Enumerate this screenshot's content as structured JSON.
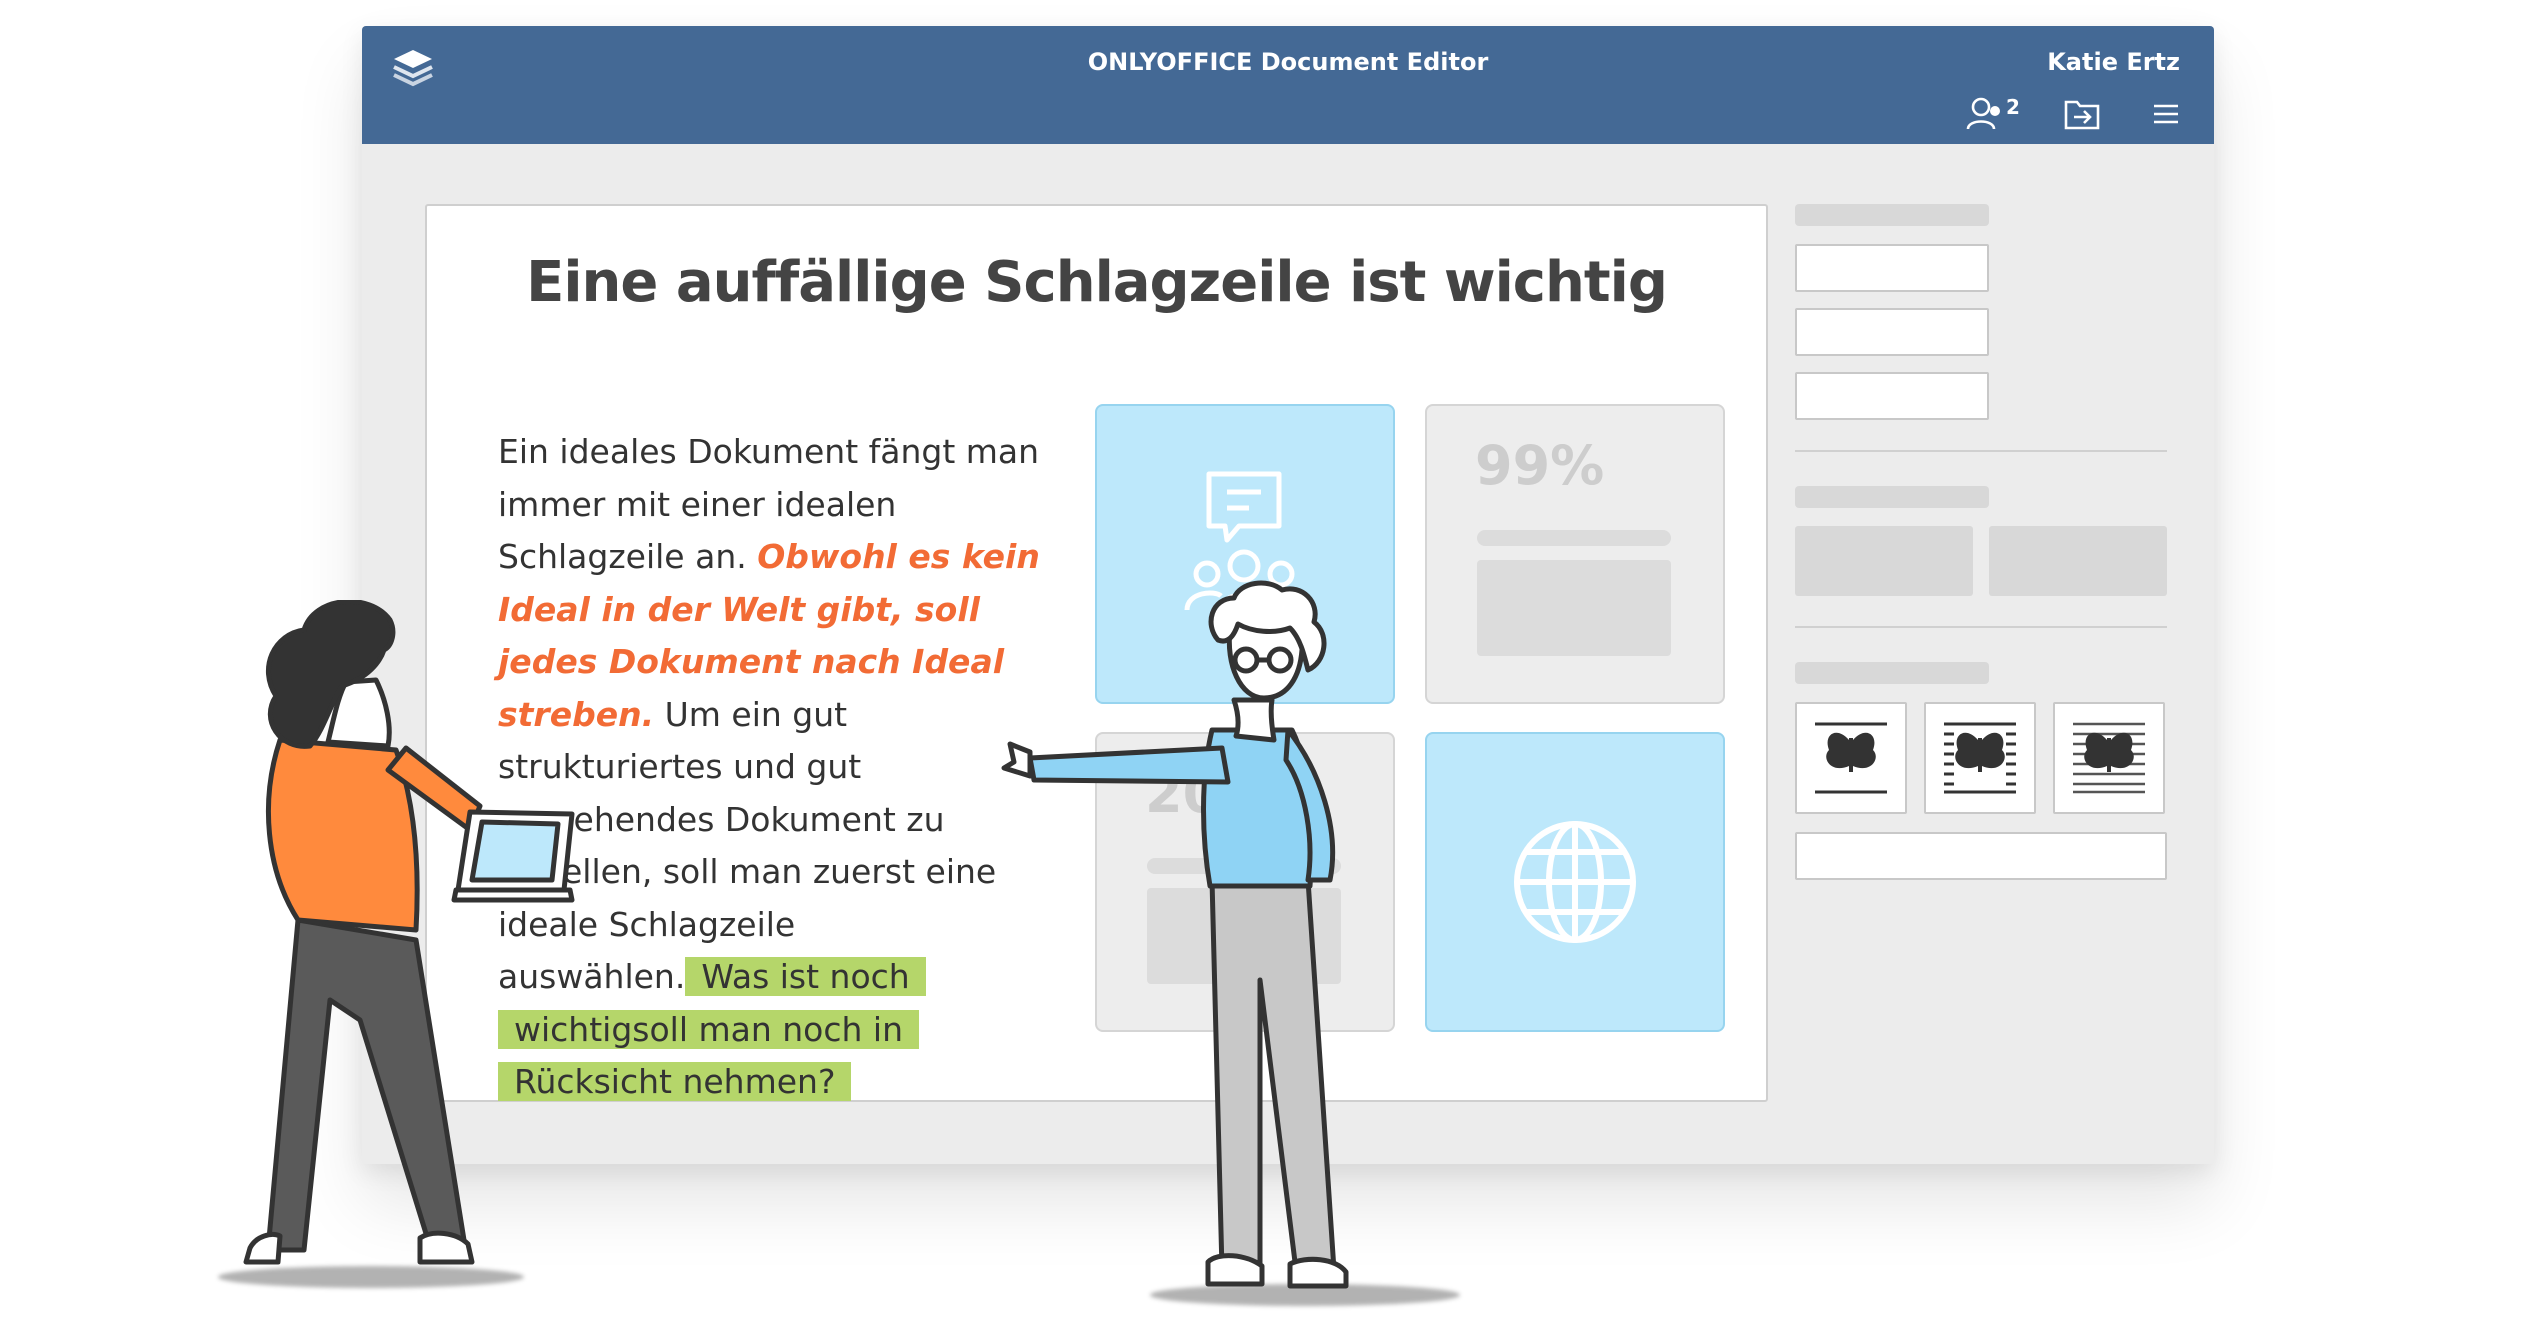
{
  "app": {
    "title": "ONLYOFFICE Document Editor",
    "user_name": "Katie Ertz",
    "users_count": "2"
  },
  "icons": {
    "logo": "layers-logo-icon",
    "users": "users-icon",
    "open_location": "folder-arrow-icon",
    "menu": "hamburger-menu-icon",
    "chat": "chat-users-icon",
    "globe": "globe-icon",
    "wrap": "butterfly-image-wrap-icon"
  },
  "document": {
    "heading": "Eine auffällige Schlagzeile ist wichtig",
    "para_plain_1": "Ein ideales Dokument fängt man immer mit einer idealen Schlagzeile an.",
    "para_emphasis": "Obwohl es kein Ideal in der Welt gibt, soll jedes Dokument nach Ideal streben.",
    "para_plain_2": "Um ein gut strukturiertes und gut aussehendes Dokument zu erstellen, soll man zuerst eine ideale Schlagzeile auswählen.",
    "para_highlight": "Was ist noch wichtigsoll man noch in Rücksicht nehmen?"
  },
  "tiles": {
    "stat_1": "99%",
    "stat_2": "20%"
  },
  "colors": {
    "titlebar": "#446995",
    "emphasis": "#f26b35",
    "highlight": "#b5d66a",
    "tile_blue": "#bde8fb"
  }
}
